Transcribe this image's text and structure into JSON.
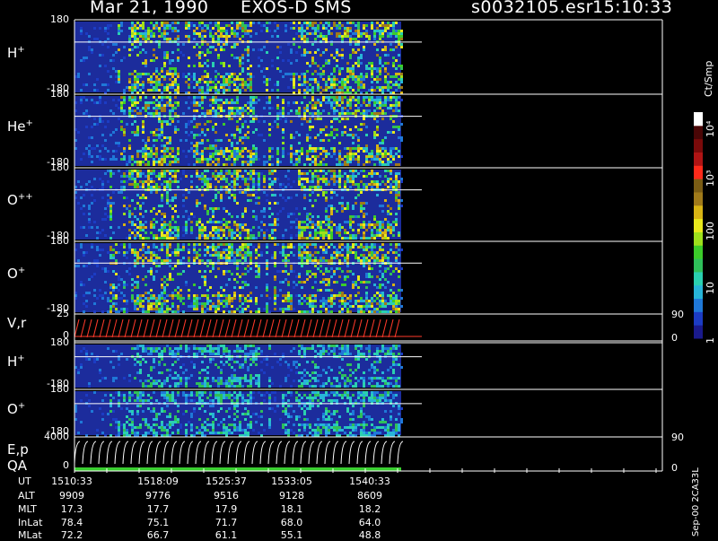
{
  "header": {
    "date": "Mar 21, 1990",
    "instrument": "EXOS-D SMS",
    "file": "s0032105.esr",
    "time": "15:10:33"
  },
  "panels": [
    {
      "id": "hplus",
      "label": "H",
      "sup": "+",
      "tick_top": "180",
      "tick_bot": "-180"
    },
    {
      "id": "heplus",
      "label": "He",
      "sup": "+",
      "tick_top": "180",
      "tick_bot": "-180"
    },
    {
      "id": "oplusplus",
      "label": "O",
      "sup": "++",
      "tick_top": "180",
      "tick_bot": "-180"
    },
    {
      "id": "oplus",
      "label": "O",
      "sup": "+",
      "tick_top": "180",
      "tick_bot": "-180"
    },
    {
      "id": "vr",
      "label": "V,r",
      "sup": "",
      "tick_top": "25",
      "tick_bot": "0",
      "rtick_top": "90",
      "rtick_bot": "0"
    },
    {
      "id": "hplus2",
      "label": "H",
      "sup": "+",
      "tick_top": "180",
      "tick_bot": "-180"
    },
    {
      "id": "oplus2",
      "label": "O",
      "sup": "+",
      "tick_top": "180",
      "tick_bot": "-180"
    },
    {
      "id": "ep",
      "label": "E,p",
      "sup": "",
      "label2": "QA",
      "tick_top": "4000",
      "tick_bot": "0",
      "rtick_top": "90",
      "rtick_bot": "0"
    }
  ],
  "colorbar": {
    "unit": "Ct/Smp",
    "ticks": [
      "10⁴",
      "10³",
      "100",
      "10",
      "1"
    ],
    "colors": [
      "#1a1a8c",
      "#1c3cc4",
      "#1f78d8",
      "#27b4d8",
      "#2ad0b0",
      "#2fbf5a",
      "#3ccc2a",
      "#9ee01c",
      "#e8e81c",
      "#d8b414",
      "#a07a1a",
      "#7a5c14",
      "#ff2a1a",
      "#b01414",
      "#7a0a0a",
      "#4a0606",
      "#ffffff"
    ]
  },
  "ephemeris": {
    "rows": [
      {
        "name": "UT",
        "values": [
          "1510:33",
          "1518:09",
          "1525:37",
          "1533:05",
          "1540:33"
        ]
      },
      {
        "name": "ALT",
        "values": [
          "9909",
          "9776",
          "9516",
          "9128",
          "8609"
        ]
      },
      {
        "name": "MLT",
        "values": [
          "17.3",
          "17.7",
          "17.9",
          "18.1",
          "18.2"
        ]
      },
      {
        "name": "InLat",
        "values": [
          "78.4",
          "75.1",
          "71.7",
          "68.0",
          "64.0"
        ]
      },
      {
        "name": "MLat",
        "values": [
          "72.2",
          "66.7",
          "61.1",
          "55.1",
          "48.8"
        ]
      }
    ]
  },
  "side_label": "Sep-00 2CA33L",
  "chart_data": {
    "type": "heatmap",
    "title": "Mar 21, 1990 EXOS-D SMS",
    "x": [
      "1510:33",
      "1518:09",
      "1525:37",
      "1533:05",
      "1540:33"
    ],
    "series": [
      {
        "name": "H+",
        "ylim": [
          -180,
          180
        ]
      },
      {
        "name": "He+",
        "ylim": [
          -180,
          180
        ]
      },
      {
        "name": "O++",
        "ylim": [
          -180,
          180
        ]
      },
      {
        "name": "O+",
        "ylim": [
          -180,
          180
        ]
      },
      {
        "name": "V,r",
        "ylim": [
          0,
          25
        ],
        "right_ylim": [
          0,
          90
        ]
      },
      {
        "name": "H+",
        "ylim": [
          -180,
          180
        ]
      },
      {
        "name": "O+",
        "ylim": [
          -180,
          180
        ]
      },
      {
        "name": "E,p",
        "ylim": [
          0,
          4000
        ],
        "right_ylim": [
          0,
          90
        ]
      }
    ],
    "colorbar_label": "Ct/Smp",
    "colorbar_ticks": [
      "1",
      "10",
      "100",
      "10³",
      "10⁴"
    ]
  }
}
